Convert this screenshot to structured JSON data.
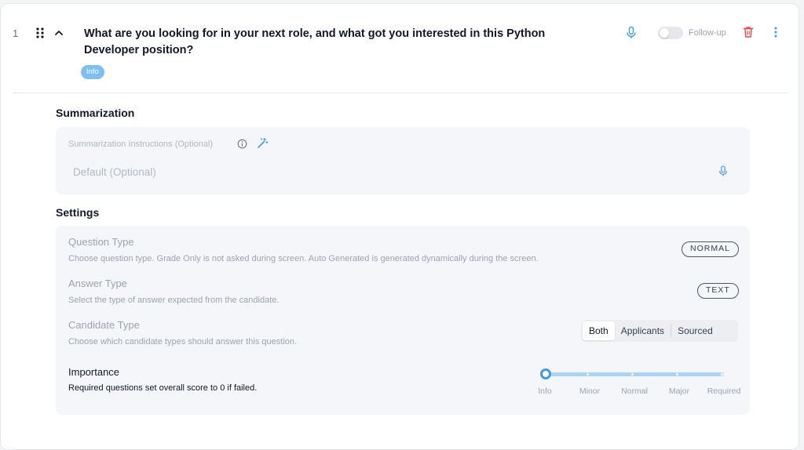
{
  "question": {
    "number": "1",
    "title": "What are you looking for in your next role, and what got you interested in this Python Developer position?",
    "tag": "Info",
    "followup_label": "Follow-up",
    "followup_enabled": false
  },
  "summarization": {
    "section_title": "Summarization",
    "label": "Summarization Instructions (Optional)",
    "placeholder": "Default (Optional)"
  },
  "settings": {
    "section_title": "Settings",
    "question_type": {
      "title": "Question Type",
      "description": "Choose question type. Grade Only is not asked during screen. Auto Generated is generated dynamically during the screen.",
      "value": "NORMAL"
    },
    "answer_type": {
      "title": "Answer Type",
      "description": "Select the type of answer expected from the candidate.",
      "value": "TEXT"
    },
    "candidate_type": {
      "title": "Candidate Type",
      "description": "Choose which candidate types should answer this question.",
      "options": [
        "Both",
        "Applicants",
        "Sourced"
      ],
      "selected": "Both"
    },
    "importance": {
      "title": "Importance",
      "description": "Required questions set overall score to 0 if failed.",
      "levels": [
        "Info",
        "Minor",
        "Normal",
        "Major",
        "Required"
      ],
      "selected": "Info",
      "selected_index": 0
    }
  },
  "icons": {
    "drag": "drag-handle-icon",
    "collapse": "chevron-up-icon",
    "mic": "microphone-icon",
    "delete": "trash-icon",
    "more": "more-vertical-icon",
    "info": "info-icon",
    "magic": "magic-wand-icon"
  },
  "colors": {
    "accent": "#3b9aee",
    "danger": "#ef4444",
    "tag_bg": "#7dbff0"
  }
}
